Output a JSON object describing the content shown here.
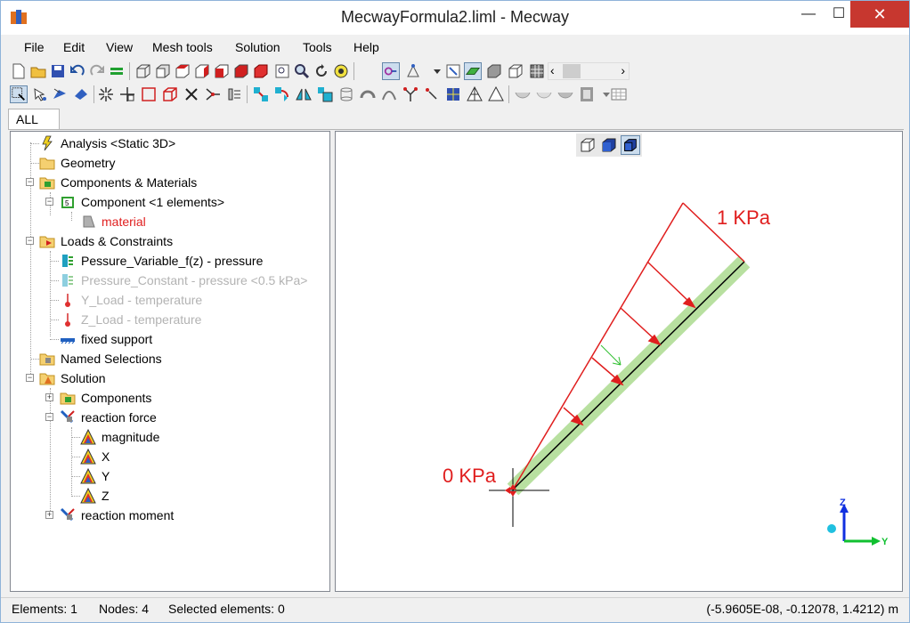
{
  "window": {
    "title": "MecwayFormula2.liml - Mecway",
    "minimize": "—",
    "maximize": "☐",
    "close": "✕"
  },
  "menu": [
    "File",
    "Edit",
    "View",
    "Mesh tools",
    "Solution",
    "Tools",
    "Help"
  ],
  "tabs": {
    "active": "ALL"
  },
  "tree": {
    "analysis": "Analysis <Static 3D>",
    "geometry": "Geometry",
    "components_materials": "Components & Materials",
    "component": "Component <1 elements>",
    "material": "material",
    "loads_constraints": "Loads & Constraints",
    "pressure_variable": "Pessure_Variable_f(z) - pressure",
    "pressure_constant": "Pressure_Constant - pressure <0.5 kPa>",
    "y_load": "Y_Load - temperature",
    "z_load": "Z_Load - temperature",
    "fixed_support": "fixed support",
    "named_selections": "Named Selections",
    "solution": "Solution",
    "components": "Components",
    "reaction_force": "reaction force",
    "magnitude": "magnitude",
    "x": "X",
    "y": "Y",
    "z": "Z",
    "reaction_moment": "reaction moment"
  },
  "viewport": {
    "label_top": "1 KPa",
    "label_bottom": "0 KPa",
    "axis_z": "Z",
    "axis_y": "Y",
    "load_color": "#e01e1e",
    "beam_color": "#b8e0a0"
  },
  "status": {
    "elements": "Elements: 1",
    "nodes": "Nodes: 4",
    "selected": "Selected elements: 0",
    "coords": "(-5.9605E-08, -0.12078, 1.4212) m"
  }
}
